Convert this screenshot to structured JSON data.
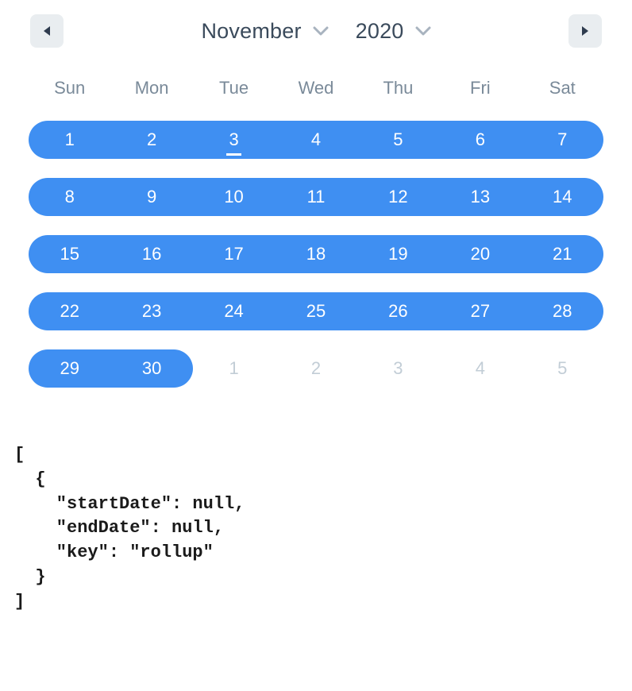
{
  "header": {
    "prev_icon": "triangle-left",
    "next_icon": "triangle-right",
    "month_label": "November",
    "year_label": "2020"
  },
  "weekdays": [
    "Sun",
    "Mon",
    "Tue",
    "Wed",
    "Thu",
    "Fri",
    "Sat"
  ],
  "weeks": [
    {
      "days": [
        {
          "n": "1",
          "selected": true,
          "start": true,
          "end": false,
          "outside": false,
          "today": false
        },
        {
          "n": "2",
          "selected": true,
          "start": false,
          "end": false,
          "outside": false,
          "today": false
        },
        {
          "n": "3",
          "selected": true,
          "start": false,
          "end": false,
          "outside": false,
          "today": true
        },
        {
          "n": "4",
          "selected": true,
          "start": false,
          "end": false,
          "outside": false,
          "today": false
        },
        {
          "n": "5",
          "selected": true,
          "start": false,
          "end": false,
          "outside": false,
          "today": false
        },
        {
          "n": "6",
          "selected": true,
          "start": false,
          "end": false,
          "outside": false,
          "today": false
        },
        {
          "n": "7",
          "selected": true,
          "start": false,
          "end": true,
          "outside": false,
          "today": false
        }
      ]
    },
    {
      "days": [
        {
          "n": "8",
          "selected": true,
          "start": true,
          "end": false,
          "outside": false,
          "today": false
        },
        {
          "n": "9",
          "selected": true,
          "start": false,
          "end": false,
          "outside": false,
          "today": false
        },
        {
          "n": "10",
          "selected": true,
          "start": false,
          "end": false,
          "outside": false,
          "today": false
        },
        {
          "n": "11",
          "selected": true,
          "start": false,
          "end": false,
          "outside": false,
          "today": false
        },
        {
          "n": "12",
          "selected": true,
          "start": false,
          "end": false,
          "outside": false,
          "today": false
        },
        {
          "n": "13",
          "selected": true,
          "start": false,
          "end": false,
          "outside": false,
          "today": false
        },
        {
          "n": "14",
          "selected": true,
          "start": false,
          "end": true,
          "outside": false,
          "today": false
        }
      ]
    },
    {
      "days": [
        {
          "n": "15",
          "selected": true,
          "start": true,
          "end": false,
          "outside": false,
          "today": false
        },
        {
          "n": "16",
          "selected": true,
          "start": false,
          "end": false,
          "outside": false,
          "today": false
        },
        {
          "n": "17",
          "selected": true,
          "start": false,
          "end": false,
          "outside": false,
          "today": false
        },
        {
          "n": "18",
          "selected": true,
          "start": false,
          "end": false,
          "outside": false,
          "today": false
        },
        {
          "n": "19",
          "selected": true,
          "start": false,
          "end": false,
          "outside": false,
          "today": false
        },
        {
          "n": "20",
          "selected": true,
          "start": false,
          "end": false,
          "outside": false,
          "today": false
        },
        {
          "n": "21",
          "selected": true,
          "start": false,
          "end": true,
          "outside": false,
          "today": false
        }
      ]
    },
    {
      "days": [
        {
          "n": "22",
          "selected": true,
          "start": true,
          "end": false,
          "outside": false,
          "today": false
        },
        {
          "n": "23",
          "selected": true,
          "start": false,
          "end": false,
          "outside": false,
          "today": false
        },
        {
          "n": "24",
          "selected": true,
          "start": false,
          "end": false,
          "outside": false,
          "today": false
        },
        {
          "n": "25",
          "selected": true,
          "start": false,
          "end": false,
          "outside": false,
          "today": false
        },
        {
          "n": "26",
          "selected": true,
          "start": false,
          "end": false,
          "outside": false,
          "today": false
        },
        {
          "n": "27",
          "selected": true,
          "start": false,
          "end": false,
          "outside": false,
          "today": false
        },
        {
          "n": "28",
          "selected": true,
          "start": false,
          "end": true,
          "outside": false,
          "today": false
        }
      ]
    },
    {
      "days": [
        {
          "n": "29",
          "selected": true,
          "start": true,
          "end": false,
          "outside": false,
          "today": false
        },
        {
          "n": "30",
          "selected": true,
          "start": false,
          "end": true,
          "outside": false,
          "today": false
        },
        {
          "n": "1",
          "selected": false,
          "start": false,
          "end": false,
          "outside": true,
          "today": false
        },
        {
          "n": "2",
          "selected": false,
          "start": false,
          "end": false,
          "outside": true,
          "today": false
        },
        {
          "n": "3",
          "selected": false,
          "start": false,
          "end": false,
          "outside": true,
          "today": false
        },
        {
          "n": "4",
          "selected": false,
          "start": false,
          "end": false,
          "outside": true,
          "today": false
        },
        {
          "n": "5",
          "selected": false,
          "start": false,
          "end": false,
          "outside": true,
          "today": false
        }
      ]
    }
  ],
  "output": "[\n  {\n    \"startDate\": null,\n    \"endDate\": null,\n    \"key\": \"rollup\"\n  }\n]"
}
